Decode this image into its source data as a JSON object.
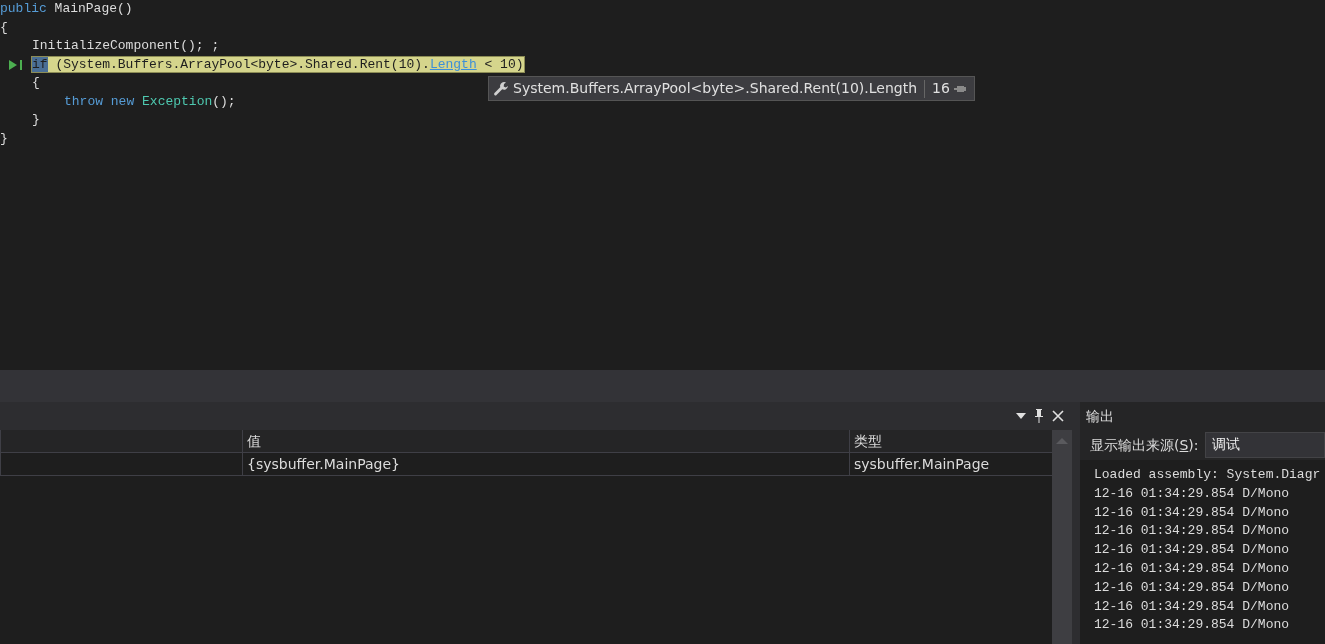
{
  "editor": {
    "lines": [
      {
        "current": false,
        "tokens": [
          {
            "text": "public ",
            "kind": "keyword"
          },
          {
            "text": "MainPage()",
            "kind": "plain"
          }
        ]
      },
      {
        "current": false,
        "tokens": [
          {
            "text": "{",
            "kind": "plain"
          }
        ],
        "children": [
          {
            "current": false,
            "tokens": [
              {
                "text": "InitializeComponent(); ;",
                "kind": "plain"
              }
            ]
          },
          {
            "current": true,
            "tokens": [
              {
                "text": "if",
                "kind": "selected"
              },
              {
                "text": " (System.Buffers.ArrayPool<byte>.Shared.Rent(10).",
                "kind": "plain"
              },
              {
                "text": "Length",
                "kind": "link"
              },
              {
                "text": " < 10)",
                "kind": "plain"
              }
            ]
          },
          {
            "current": false,
            "tokens": [
              {
                "text": "{",
                "kind": "plain"
              }
            ],
            "children": [
              {
                "current": false,
                "tokens": [
                  {
                    "text": "throw ",
                    "kind": "keyword"
                  },
                  {
                    "text": "new ",
                    "kind": "keyword"
                  },
                  {
                    "text": "Exception",
                    "kind": "type"
                  },
                  {
                    "text": "();",
                    "kind": "plain"
                  }
                ]
              }
            ]
          },
          {
            "current": false,
            "tokens": [
              {
                "text": "}",
                "kind": "plain"
              }
            ]
          }
        ]
      },
      {
        "current": false,
        "tokens": [
          {
            "text": "}",
            "kind": "plain"
          }
        ]
      }
    ]
  },
  "datatip": {
    "expression": "System.Buffers.ArrayPool<byte>.Shared.Rent(10).Length",
    "value": "16"
  },
  "locals": {
    "columns": [
      "值",
      "类型"
    ],
    "rows": [
      {
        "cells": [
          "{sysbuffer.MainPage}",
          "sysbuffer.MainPage"
        ]
      }
    ]
  },
  "output": {
    "title": "输出",
    "source_label_before": "显示输出来源(",
    "source_access_key": "S",
    "source_label_after": "):",
    "source_value": "调试",
    "lines": [
      "Loaded assembly: System.Diagr",
      "12-16 01:34:29.854 D/Mono",
      "12-16 01:34:29.854 D/Mono",
      "12-16 01:34:29.854 D/Mono",
      "12-16 01:34:29.854 D/Mono",
      "12-16 01:34:29.854 D/Mono",
      "12-16 01:34:29.854 D/Mono",
      "12-16 01:34:29.854 D/Mono",
      "12-16 01:34:29.854 D/Mono"
    ]
  }
}
